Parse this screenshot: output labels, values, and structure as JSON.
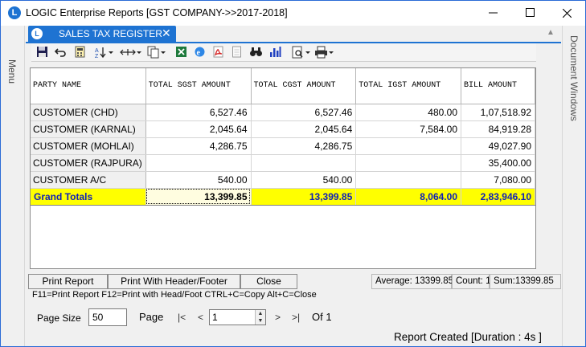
{
  "window": {
    "title": "LOGIC Enterprise Reports  [GST COMPANY->>2017-2018]",
    "logo_letter": "L",
    "minimize_icon": "minimize-icon",
    "maximize_icon": "maximize-icon",
    "close_icon": "close-icon"
  },
  "side_panels": {
    "left_label": "Menu",
    "right_label": "Document Windows"
  },
  "doc_tab": {
    "label": "SALES TAX REGISTER",
    "icon_letter": "L",
    "close": "✕"
  },
  "toolbar": {
    "icons": [
      "save-icon",
      "undo-icon",
      "calculator-icon",
      "sort-az-icon",
      "column-width-icon",
      "copy-icon",
      "excel-icon",
      "ie-icon",
      "pdf-icon",
      "blank-page-icon",
      "find-icon",
      "chart-icon",
      "print-preview-icon",
      "printer-icon"
    ]
  },
  "grid": {
    "columns": [
      "PARTY NAME",
      "TOTAL SGST AMOUNT",
      "TOTAL CGST AMOUNT",
      "TOTAL IGST AMOUNT",
      "BILL AMOUNT"
    ],
    "rows": [
      [
        "CUSTOMER (CHD)",
        "6,527.46",
        "6,527.46",
        "480.00",
        "1,07,518.92"
      ],
      [
        "CUSTOMER (KARNAL)",
        "2,045.64",
        "2,045.64",
        "7,584.00",
        "84,919.28"
      ],
      [
        "CUSTOMER (MOHLAI)",
        "4,286.75",
        "4,286.75",
        "",
        "49,027.90"
      ],
      [
        "CUSTOMER (RAJPURA)",
        "",
        "",
        "",
        "35,400.00"
      ],
      [
        "CUSTOMER A/C",
        "540.00",
        "540.00",
        "",
        "7,080.00"
      ]
    ],
    "totals": [
      "Grand Totals",
      "13,399.85",
      "13,399.85",
      "8,064.00",
      "2,83,946.10"
    ]
  },
  "actions": {
    "print_report": "Print Report",
    "print_header_footer": "Print With Header/Footer",
    "close": "Close",
    "hint": "F11=Print Report  F12=Print with Head/Foot  CTRL+C=Copy  Alt+C=Close"
  },
  "status": {
    "average": "Average: 13399.85",
    "count": "Count: 1",
    "sum": "Sum:13399.85"
  },
  "pager": {
    "page_size_label": "Page Size",
    "page_size_value": "50",
    "page_label": "Page",
    "first": "|<",
    "prev": "<",
    "page_value": "1",
    "next": ">",
    "last": ">|",
    "of": "Of 1"
  },
  "footer": {
    "report_created": "Report Created [Duration : 4s ]"
  }
}
